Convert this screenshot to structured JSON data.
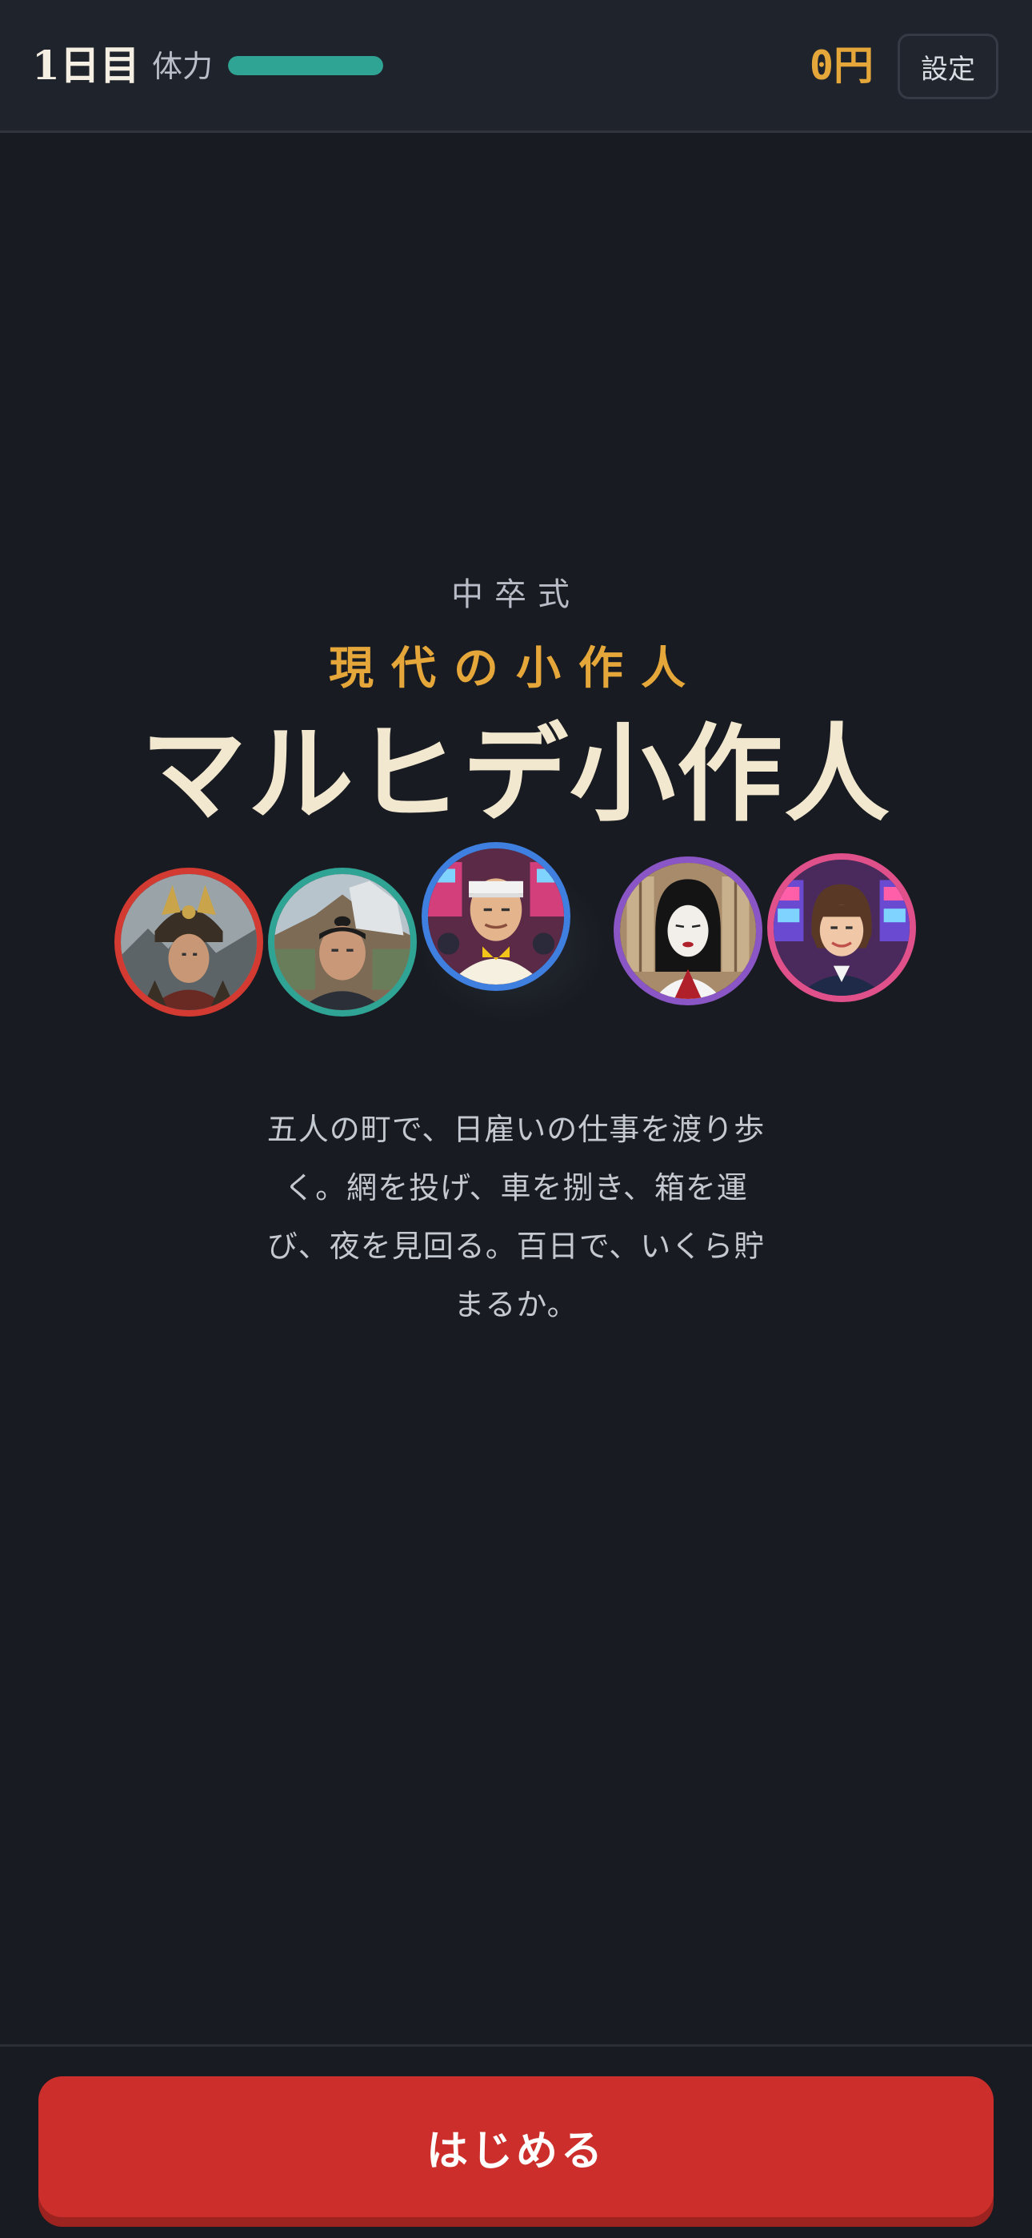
{
  "header": {
    "day_label": "1日目",
    "stamina_label": "体力",
    "stamina_level": 1.0,
    "money": "0円",
    "settings_label": "設定"
  },
  "title": {
    "subtitle_small": "中卒式",
    "subtitle_gold": "現代の小作人",
    "main": "マルヒデ小作人"
  },
  "characters": [
    {
      "name": "samurai-general",
      "border": "#d23a32"
    },
    {
      "name": "topknot-man",
      "border": "#2fa394"
    },
    {
      "name": "headband-man",
      "border": "#3f7fe0"
    },
    {
      "name": "white-faced-woman",
      "border": "#8a55c4"
    },
    {
      "name": "pachinko-woman",
      "border": "#e0508a"
    }
  ],
  "description": "五人の町で、日雇いの仕事を渡り歩く。網を投げ、車を捌き、箱を運び、夜を見回る。百日で、いくら貯まるか。",
  "footer": {
    "start_label": "はじめる"
  },
  "colors": {
    "background": "#181b21",
    "accent_gold": "#e6a73a",
    "stamina": "#2fa394",
    "start_button": "#cc2f2b"
  }
}
